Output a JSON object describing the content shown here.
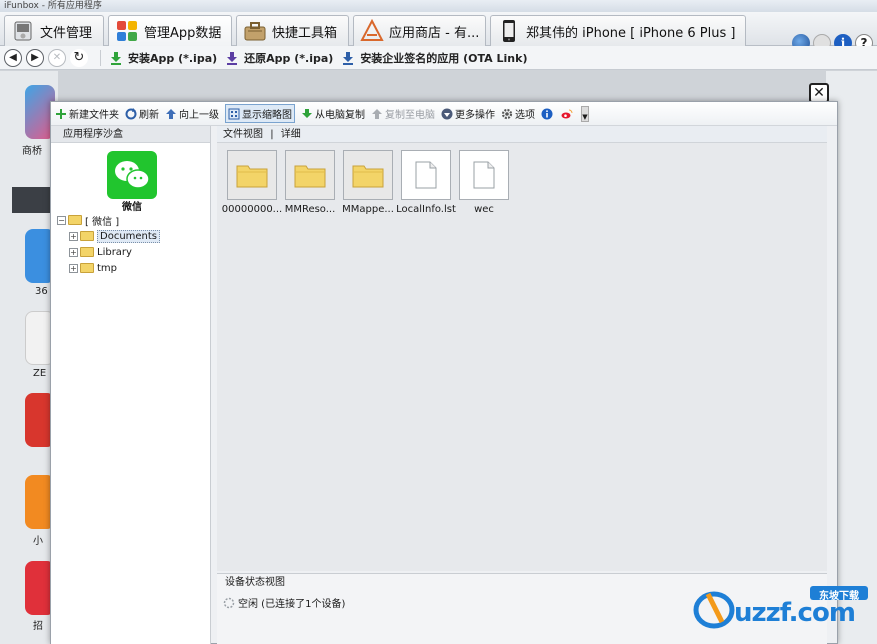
{
  "window": {
    "title": "iFunbox - 所有应用程序"
  },
  "tabs": [
    {
      "label": "文件管理",
      "active": false
    },
    {
      "label": "管理App数据",
      "active": true
    },
    {
      "label": "快捷工具箱",
      "active": false
    },
    {
      "label": "应用商店 - 有...",
      "active": false
    },
    {
      "label": "郑其伟的 iPhone [ iPhone 6 Plus ]",
      "active": false
    }
  ],
  "navbar": {
    "install_app": "安装App (*.ipa)",
    "restore_app": "还原App (*.ipa)",
    "install_enterprise": "安装企业签名的应用 (OTA Link)"
  },
  "background_labels": [
    "商桥",
    "36",
    "ZE",
    "小",
    "招"
  ],
  "dialog": {
    "toolbar": {
      "new_folder": "新建文件夹",
      "refresh": "刷新",
      "up_level": "向上一级",
      "show_thumbs": "显示缩略图",
      "copy_from_pc": "从电脑复制",
      "copy_to_pc": "复制至电脑",
      "more_ops": "更多操作",
      "options": "选项"
    },
    "sidebar": {
      "header": "应用程序沙盒",
      "app_name": "微信",
      "tree": {
        "root": "[ 微信 ]",
        "children": [
          "Documents",
          "Library",
          "tmp"
        ]
      }
    },
    "main": {
      "nav_view": "文件视图",
      "nav_sep": "|",
      "nav_detail": "详细",
      "files": [
        {
          "name": "00000000...",
          "kind": "folder"
        },
        {
          "name": "MMReso...",
          "kind": "folder"
        },
        {
          "name": "MMappe...",
          "kind": "folder"
        },
        {
          "name": "LocalInfo.lst",
          "kind": "document"
        },
        {
          "name": "wec",
          "kind": "document"
        }
      ]
    },
    "status": {
      "header": "设备状态视图",
      "text": "空闲 (已连接了1个设备)"
    }
  },
  "watermark": {
    "text": "uzzf.com",
    "badge": "东坡下载"
  },
  "colors": {
    "wechat_green": "#21c52e",
    "folder": "#f3d468",
    "navy_arrow": "#2d5fa8"
  }
}
